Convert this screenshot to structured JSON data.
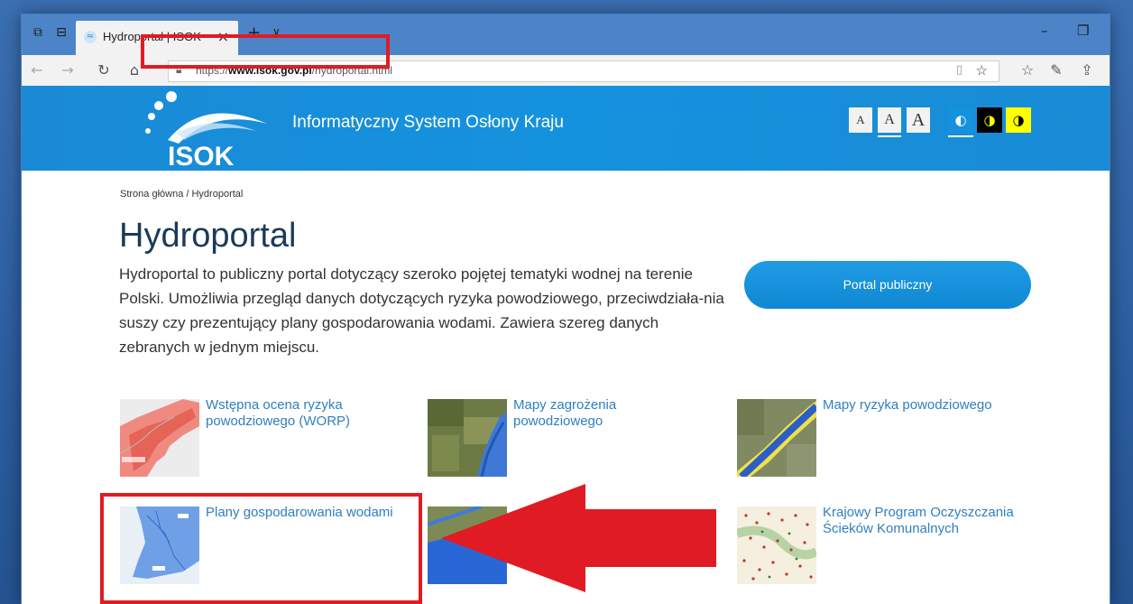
{
  "browser": {
    "tab_title": "Hydroportal | ISOK",
    "url_prefix": "https://",
    "url_domain": "www.isok.gov.pl",
    "url_path": "/hydroportal.html"
  },
  "site": {
    "logo_text": "ISOK",
    "title": "Informatyczny System Osłony Kraju",
    "font_size_labels": [
      "A",
      "A",
      "A"
    ]
  },
  "breadcrumb": "Strona główna / Hydroportal",
  "page": {
    "title": "Hydroportal",
    "description": "Hydroportal to publiczny portal dotyczący szeroko pojętej tematyki wodnej na terenie Polski. Umożliwia przegląd danych dotyczących ryzyka powodziowego, przeciwdziała-nia suszy czy prezentujący plany gospodarowania wodami. Zawiera szereg danych zebranych w jednym miejscu.",
    "portal_button": "Portal publiczny"
  },
  "items": [
    {
      "label": "Wstępna ocena ryzyka powodziowego (WORP)"
    },
    {
      "label": "Mapy zagrożenia powodziowego"
    },
    {
      "label": "Mapy ryzyka powodziowego"
    },
    {
      "label": "Plany gospodarowania wodami"
    },
    {
      "label": ""
    },
    {
      "label": "Krajowy Program Oczyszczania Ścieków Komunalnych"
    }
  ],
  "colors": {
    "header_blue": "#1592dd",
    "highlight_red": "#e01b24",
    "link_blue": "#2f7fbf"
  }
}
